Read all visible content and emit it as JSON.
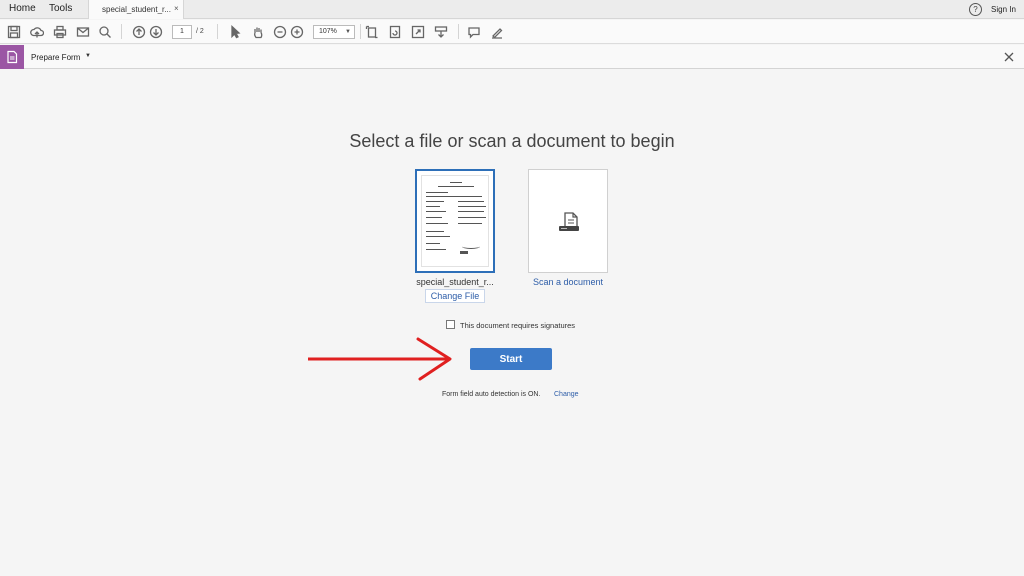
{
  "menubar": {
    "home_label": "Home",
    "tools_label": "Tools",
    "tab_label": "special_student_r...",
    "tab_close": "×",
    "help_glyph": "?",
    "signin_label": "Sign In"
  },
  "toolbar": {
    "page_current": "1",
    "page_total": "/ 2",
    "zoom": "107%",
    "icons": [
      "save-icon",
      "cloud-upload-icon",
      "print-icon",
      "email-icon",
      "search-icon",
      "page-up-icon",
      "page-down-icon",
      "select-cursor-icon",
      "hand-icon",
      "zoom-out-icon",
      "zoom-in-icon",
      "fit-page-icon",
      "rotate-icon",
      "full-screen-icon",
      "scroll-mode-icon",
      "comment-icon",
      "sign-pen-icon"
    ]
  },
  "toolpane": {
    "title": "Prepare Form",
    "caret": "▼",
    "accent_color": "#9b56a4"
  },
  "main": {
    "heading": "Select a file or scan a document to begin",
    "file_name": "special_student_r...",
    "change_file_label": "Change File",
    "scan_label": "Scan a document",
    "signature_checkbox_label": "This document requires signatures",
    "signature_checked": false,
    "start_label": "Start",
    "detection_text": "Form field auto detection is ON.",
    "detection_change_label": "Change",
    "accent_color": "#3c7ac8",
    "arrow_color": "#e02020"
  }
}
